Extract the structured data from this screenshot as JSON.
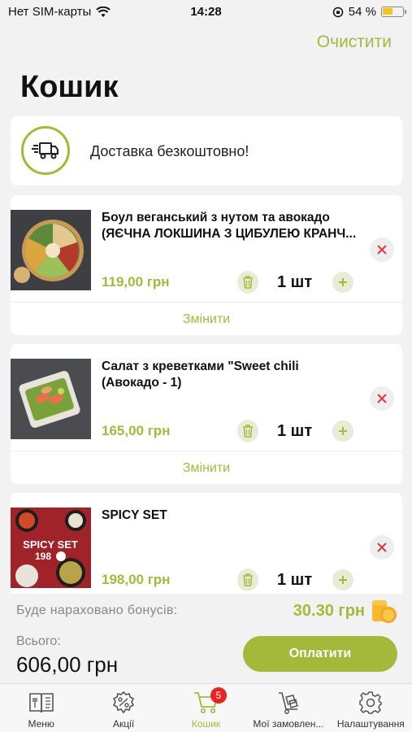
{
  "status_bar": {
    "carrier": "Нет SIM-карты",
    "time": "14:28",
    "battery_text": "54 %",
    "battery_level_percent": 54
  },
  "header": {
    "clear_label": "Очистити",
    "title": "Кошик"
  },
  "delivery": {
    "text": "Доставка безкоштовно!"
  },
  "items": [
    {
      "name_line1": "Боул веганський з нутом та авокадо",
      "name_line2": "(ЯЄЧНА ЛОКШИНА З ЦИБУЛЕЮ КРАНЧ...",
      "price": "119,00 грн",
      "quantity": "1 шт",
      "change_label": "Змінити"
    },
    {
      "name_line1": "Салат з креветками \"Sweet chili",
      "name_line2": "(Авокадо - 1)",
      "price": "165,00 грн",
      "quantity": "1 шт",
      "change_label": "Змінити"
    },
    {
      "name_line1": "SPICY SET",
      "name_line2": "",
      "price": "198,00 грн",
      "quantity": "1 шт",
      "image_text": "SPICY SET",
      "image_price": "198"
    }
  ],
  "summary": {
    "bonus_label": "Буде нараховано бонусів:",
    "bonus_value": "30.30 грн",
    "total_label": "Всього:",
    "total_value": "606,00 грн",
    "pay_label": "Оплатити"
  },
  "tabs": [
    {
      "label": "Меню",
      "icon": "menu-book-icon"
    },
    {
      "label": "Акції",
      "icon": "discount-icon"
    },
    {
      "label": "Кошик",
      "icon": "cart-icon",
      "badge": "5"
    },
    {
      "label": "Мої замовлен...",
      "icon": "orders-icon"
    },
    {
      "label": "Налаштування",
      "icon": "gear-icon"
    }
  ],
  "colors": {
    "accent": "#a4b93a",
    "background": "#f2f2f2",
    "badge": "#e22222"
  }
}
